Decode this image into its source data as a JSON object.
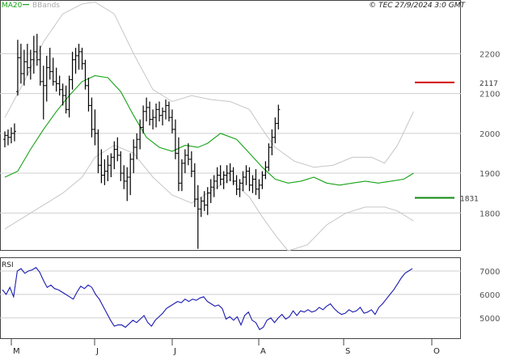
{
  "header": {
    "copyright": "© TEC 27/9/2024 3:0 GMT",
    "legend_ma": "MA20",
    "legend_bb": "BBands"
  },
  "colors": {
    "price": "#000000",
    "ma": "#16a316",
    "bbands": "#c6c6c6",
    "rsi": "#1a1ab0",
    "resistance": "#d10000",
    "support": "#0c8a0c",
    "grid": "#cfcfcf"
  },
  "chart_data": [
    {
      "type": "line",
      "name": "price-panel",
      "ylim": [
        1705,
        2335
      ],
      "yticks": [
        {
          "label": "2200",
          "value": 2200
        },
        {
          "label": "2100",
          "value": 2100
        },
        {
          "label": "2000",
          "value": 2000
        },
        {
          "label": "1900",
          "value": 1900
        },
        {
          "label": "1800",
          "value": 1800
        }
      ],
      "xticks": [
        "M",
        "J",
        "J",
        "A",
        "S",
        "O"
      ],
      "resistance": {
        "label": "2117",
        "value": 2128
      },
      "support": {
        "label": "1831",
        "value": 1838
      },
      "bars": [
        [
          1985,
          2005,
          1965,
          1995
        ],
        [
          1995,
          2010,
          1970,
          1990
        ],
        [
          1990,
          2015,
          1975,
          2000
        ],
        [
          2000,
          2025,
          1980,
          2005
        ],
        [
          2105,
          2235,
          2095,
          2190
        ],
        [
          2190,
          2225,
          2125,
          2150
        ],
        [
          2150,
          2210,
          2120,
          2180
        ],
        [
          2180,
          2225,
          2145,
          2165
        ],
        [
          2165,
          2210,
          2135,
          2185
        ],
        [
          2185,
          2245,
          2150,
          2205
        ],
        [
          2205,
          2250,
          2170,
          2185
        ],
        [
          2185,
          2220,
          2120,
          2130
        ],
        [
          2130,
          2170,
          2035,
          2120
        ],
        [
          2120,
          2195,
          2080,
          2165
        ],
        [
          2165,
          2215,
          2135,
          2155
        ],
        [
          2155,
          2190,
          2120,
          2130
        ],
        [
          2130,
          2165,
          2105,
          2125
        ],
        [
          2125,
          2145,
          2095,
          2110
        ],
        [
          2110,
          2125,
          2070,
          2095
        ],
        [
          2095,
          2120,
          2050,
          2060
        ],
        [
          2060,
          2145,
          2040,
          2135
        ],
        [
          2135,
          2205,
          2110,
          2185
        ],
        [
          2185,
          2215,
          2150,
          2195
        ],
        [
          2195,
          2225,
          2160,
          2205
        ],
        [
          2205,
          2215,
          2160,
          2175
        ],
        [
          2175,
          2185,
          2110,
          2120
        ],
        [
          2120,
          2140,
          2055,
          2070
        ],
        [
          2070,
          2090,
          1990,
          2010
        ],
        [
          2010,
          2060,
          1970,
          2000
        ],
        [
          2000,
          2010,
          1900,
          1920
        ],
        [
          1920,
          1960,
          1875,
          1895
        ],
        [
          1895,
          1935,
          1870,
          1905
        ],
        [
          1905,
          1945,
          1880,
          1920
        ],
        [
          1920,
          1950,
          1890,
          1940
        ],
        [
          1940,
          1980,
          1910,
          1960
        ],
        [
          1960,
          1990,
          1930,
          1945
        ],
        [
          1945,
          1955,
          1880,
          1900
        ],
        [
          1900,
          1920,
          1860,
          1880
        ],
        [
          1880,
          1915,
          1830,
          1890
        ],
        [
          1890,
          1950,
          1845,
          1935
        ],
        [
          1935,
          1985,
          1900,
          1965
        ],
        [
          1965,
          2000,
          1935,
          1985
        ],
        [
          1985,
          2035,
          1960,
          2015
        ],
        [
          2015,
          2070,
          2000,
          2055
        ],
        [
          2055,
          2090,
          2030,
          2065
        ],
        [
          2065,
          2080,
          2020,
          2035
        ],
        [
          2035,
          2060,
          2010,
          2040
        ],
        [
          2040,
          2075,
          2015,
          2060
        ],
        [
          2060,
          2080,
          2030,
          2045
        ],
        [
          2045,
          2065,
          2020,
          2055
        ],
        [
          2055,
          2085,
          2035,
          2070
        ],
        [
          2070,
          2080,
          2030,
          2040
        ],
        [
          2040,
          2060,
          2000,
          2010
        ],
        [
          2010,
          2035,
          1935,
          1950
        ],
        [
          1950,
          1990,
          1855,
          1875
        ],
        [
          1875,
          1935,
          1855,
          1925
        ],
        [
          1925,
          1960,
          1900,
          1945
        ],
        [
          1945,
          1975,
          1920,
          1935
        ],
        [
          1935,
          1955,
          1890,
          1905
        ],
        [
          1905,
          1925,
          1815,
          1835
        ],
        [
          1835,
          1870,
          1710,
          1810
        ],
        [
          1810,
          1840,
          1790,
          1830
        ],
        [
          1830,
          1855,
          1805,
          1820
        ],
        [
          1820,
          1865,
          1795,
          1850
        ],
        [
          1850,
          1885,
          1825,
          1865
        ],
        [
          1865,
          1895,
          1840,
          1880
        ],
        [
          1880,
          1915,
          1860,
          1895
        ],
        [
          1895,
          1920,
          1870,
          1885
        ],
        [
          1885,
          1905,
          1860,
          1895
        ],
        [
          1895,
          1920,
          1875,
          1900
        ],
        [
          1900,
          1925,
          1880,
          1905
        ],
        [
          1905,
          1915,
          1870,
          1880
        ],
        [
          1880,
          1895,
          1845,
          1860
        ],
        [
          1860,
          1885,
          1840,
          1875
        ],
        [
          1875,
          1905,
          1855,
          1890
        ],
        [
          1890,
          1920,
          1870,
          1905
        ],
        [
          1905,
          1915,
          1855,
          1870
        ],
        [
          1870,
          1895,
          1850,
          1885
        ],
        [
          1885,
          1910,
          1845,
          1860
        ],
        [
          1860,
          1885,
          1835,
          1870
        ],
        [
          1870,
          1905,
          1860,
          1895
        ],
        [
          1895,
          1930,
          1885,
          1915
        ],
        [
          1915,
          1975,
          1905,
          1965
        ],
        [
          1965,
          2010,
          1945,
          1990
        ],
        [
          1990,
          2040,
          1975,
          2025
        ],
        [
          2025,
          2072,
          2010,
          2060
        ]
      ],
      "ma20": [
        [
          0,
          1890
        ],
        [
          4,
          1905
        ],
        [
          8,
          1960
        ],
        [
          12,
          2010
        ],
        [
          16,
          2055
        ],
        [
          20,
          2095
        ],
        [
          24,
          2130
        ],
        [
          28,
          2145
        ],
        [
          32,
          2140
        ],
        [
          36,
          2105
        ],
        [
          40,
          2045
        ],
        [
          44,
          1990
        ],
        [
          48,
          1965
        ],
        [
          52,
          1955
        ],
        [
          56,
          1970
        ],
        [
          60,
          1965
        ],
        [
          63,
          1975
        ],
        [
          67,
          2000
        ],
        [
          72,
          1985
        ],
        [
          76,
          1950
        ],
        [
          80,
          1915
        ],
        [
          84,
          1885
        ],
        [
          88,
          1875
        ],
        [
          92,
          1880
        ],
        [
          96,
          1890
        ],
        [
          100,
          1875
        ],
        [
          104,
          1870
        ],
        [
          108,
          1875
        ],
        [
          112,
          1880
        ],
        [
          116,
          1875
        ],
        [
          120,
          1880
        ],
        [
          124,
          1885
        ],
        [
          127,
          1900
        ]
      ],
      "bb_upper": [
        [
          0,
          2040
        ],
        [
          6,
          2130
        ],
        [
          12,
          2230
        ],
        [
          18,
          2300
        ],
        [
          24,
          2325
        ],
        [
          28,
          2330
        ],
        [
          34,
          2300
        ],
        [
          40,
          2200
        ],
        [
          46,
          2110
        ],
        [
          52,
          2080
        ],
        [
          58,
          2095
        ],
        [
          64,
          2085
        ],
        [
          70,
          2080
        ],
        [
          76,
          2060
        ],
        [
          80,
          2010
        ],
        [
          84,
          1965
        ],
        [
          90,
          1930
        ],
        [
          96,
          1915
        ],
        [
          102,
          1920
        ],
        [
          108,
          1940
        ],
        [
          114,
          1940
        ],
        [
          118,
          1925
        ],
        [
          122,
          1970
        ],
        [
          127,
          2055
        ]
      ],
      "bb_lower": [
        [
          0,
          1760
        ],
        [
          6,
          1790
        ],
        [
          12,
          1820
        ],
        [
          18,
          1850
        ],
        [
          24,
          1890
        ],
        [
          28,
          1940
        ],
        [
          34,
          1970
        ],
        [
          40,
          1950
        ],
        [
          46,
          1890
        ],
        [
          52,
          1845
        ],
        [
          58,
          1825
        ],
        [
          64,
          1855
        ],
        [
          70,
          1885
        ],
        [
          76,
          1840
        ],
        [
          80,
          1790
        ],
        [
          84,
          1745
        ],
        [
          88,
          1705
        ],
        [
          94,
          1720
        ],
        [
          100,
          1770
        ],
        [
          106,
          1800
        ],
        [
          112,
          1815
        ],
        [
          118,
          1815
        ],
        [
          122,
          1805
        ],
        [
          127,
          1780
        ]
      ]
    },
    {
      "type": "line",
      "name": "rsi-panel",
      "ylim": [
        4100,
        7550
      ],
      "yticks": [
        {
          "label": "7000",
          "value": 7000
        },
        {
          "label": "6000",
          "value": 6000
        },
        {
          "label": "5000",
          "value": 5000
        }
      ],
      "legend": "RSI",
      "values": [
        6200,
        6000,
        6300,
        5900,
        7000,
        7100,
        6900,
        7000,
        7050,
        7150,
        6950,
        6600,
        6300,
        6400,
        6250,
        6200,
        6100,
        6000,
        5900,
        5800,
        6100,
        6350,
        6250,
        6400,
        6300,
        6000,
        5800,
        5500,
        5200,
        4900,
        4650,
        4700,
        4700,
        4600,
        4750,
        4900,
        4800,
        4950,
        5100,
        4800,
        4650,
        4900,
        5050,
        5200,
        5400,
        5500,
        5600,
        5700,
        5650,
        5800,
        5700,
        5800,
        5750,
        5850,
        5900,
        5700,
        5600,
        5500,
        5550,
        5400,
        4950,
        5050,
        4900,
        5050,
        4700,
        5100,
        5250,
        4900,
        4800,
        4500,
        4600,
        4900,
        5000,
        4800,
        5000,
        5150,
        4950,
        5050,
        5300,
        5100,
        5300,
        5250,
        5350,
        5250,
        5300,
        5450,
        5350,
        5500,
        5600,
        5400,
        5250,
        5150,
        5200,
        5350,
        5250,
        5300,
        5450,
        5200,
        5250,
        5350,
        5150,
        5450,
        5600,
        5800,
        6000,
        6200,
        6450,
        6700,
        6900,
        7000,
        7100
      ]
    }
  ]
}
